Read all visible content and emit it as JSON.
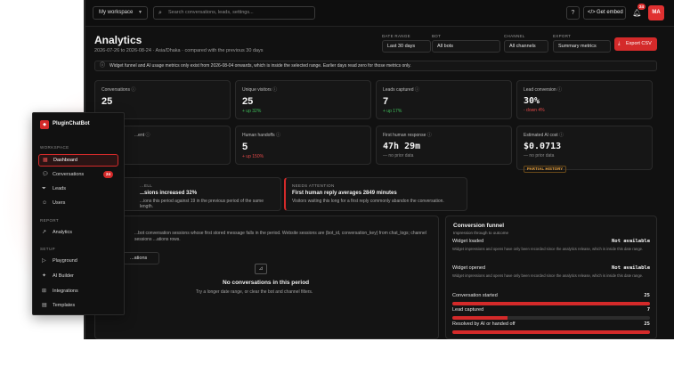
{
  "topbar": {
    "workspace": "My workspace",
    "search_placeholder": "Search conversations, leads, settings...",
    "embed_label": "Get embed",
    "notification_count": "24",
    "avatar_initials": "MA"
  },
  "header": {
    "title": "Analytics",
    "subtitle": "2026-07-26 to 2026-08-24 · Asia/Dhaka · compared with the previous 30 days"
  },
  "filters": [
    {
      "label": "DATE RANGE",
      "value": "Last 30 days"
    },
    {
      "label": "BOT",
      "value": "All bots"
    },
    {
      "label": "CHANNEL",
      "value": "All channels"
    },
    {
      "label": "EXPORT",
      "value": "Summary metrics"
    }
  ],
  "export_button": "Export CSV",
  "notice": "Widget funnel and AI usage metrics only exist from 2026-08-04 onwards, which is inside the selected range. Earlier days read zero for those metrics only.",
  "metrics": [
    {
      "label": "Conversations",
      "value": "25",
      "delta": ""
    },
    {
      "label": "Unique visitors",
      "value": "25",
      "delta": "+ up 32%"
    },
    {
      "label": "Leads captured",
      "value": "7",
      "delta": "+ up 17%"
    },
    {
      "label": "Lead conversion",
      "value": "30%",
      "delta": "- down 4%"
    },
    {
      "label": "...ent",
      "value": "",
      "delta": ""
    },
    {
      "label": "Human handoffs",
      "value": "5",
      "delta": "+ up 150%"
    },
    {
      "label": "First human response",
      "value": "47h 29m",
      "delta": "— no prior data"
    },
    {
      "label": "Estimated AI cost",
      "value": "$0.0713",
      "delta": "— no prior data",
      "badge": "PARTIAL HISTORY"
    }
  ],
  "insights": [
    {
      "label": "...ELL",
      "title": "...sions increased 32%",
      "desc": "...ions this period against 19 in the previous period of the same length."
    },
    {
      "label": "NEEDS ATTENTION",
      "title": "First human reply averages 2849 minutes",
      "desc": "Visitors waiting this long for a first reply commonly abandon the conversation."
    }
  ],
  "conversations_panel": {
    "desc": "...bot conversation sessions whose first stored message falls in the period. Website sessions are (bot_id, conversation_key) from chat_logs; channel sessions ...ations rows.",
    "button": "...ations",
    "empty_title": "No conversations in this period",
    "empty_sub": "Try a longer date range, or clear the bot and channel filters."
  },
  "funnel": {
    "title": "Conversion funnel",
    "subtitle": "Impression through to outcome",
    "rows": [
      {
        "name": "Widget loaded",
        "value": "Not available",
        "note": "Widget impressions and opens have only been recorded since the analytics release, which is inside this date range."
      },
      {
        "name": "Widget opened",
        "value": "Not available",
        "note": "Widget impressions and opens have only been recorded since the analytics release, which is inside this date range."
      },
      {
        "name": "Conversation started",
        "value": "25",
        "fill": 1.0
      },
      {
        "name": "Lead captured",
        "value": "7",
        "fill": 0.28
      },
      {
        "name": "Resolved by AI or handed off",
        "value": "25",
        "fill": 1.0
      }
    ]
  },
  "sidebar": {
    "brand": "PluginChatBot",
    "sections": [
      {
        "title": "WORKSPACE",
        "items": [
          {
            "label": "Dashboard",
            "icon": "grid-icon",
            "active": true
          },
          {
            "label": "Conversations",
            "icon": "chat-icon",
            "badge": "24"
          },
          {
            "label": "Leads",
            "icon": "funnel-icon"
          },
          {
            "label": "Users",
            "icon": "user-icon"
          }
        ]
      },
      {
        "title": "REPORT",
        "items": [
          {
            "label": "Analytics",
            "icon": "chart-icon"
          }
        ]
      },
      {
        "title": "SETUP",
        "items": [
          {
            "label": "Playground",
            "icon": "play-icon"
          },
          {
            "label": "AI Builder",
            "icon": "sparkle-icon"
          },
          {
            "label": "Integrations",
            "icon": "plug-icon"
          },
          {
            "label": "Templates",
            "icon": "doc-icon"
          }
        ]
      }
    ]
  },
  "colors": {
    "accent": "#d42a2a",
    "background": "#111111",
    "positive": "#3fbf5a",
    "negative": "#e04848"
  }
}
